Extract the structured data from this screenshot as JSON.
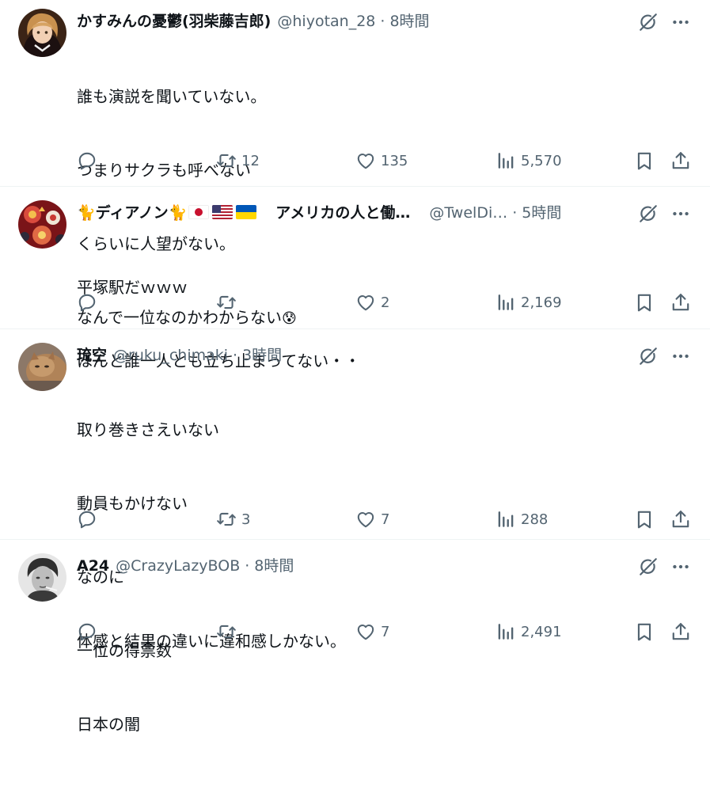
{
  "replies": [
    {
      "name": "かすみんの憂鬱(羽柴藤吉郎)",
      "handle": "@hiyotan_28",
      "time": "8時間",
      "lines": [
        "誰も演説を聞いていない。",
        "つまりサクラも呼べない",
        "くらいに人望がない。",
        "なんで一位なのかわからない"
      ],
      "emoji": "😰",
      "reply_count": "",
      "retweet_count": "12",
      "like_count": "135",
      "view_count": "5,570"
    },
    {
      "name_prefix": "🐈ディアノン🐈",
      "name_suffix": "アメリカの人と働…",
      "handle": "@TwelDi…",
      "time": "5時間",
      "lines": [
        "平塚駅だｗｗｗ",
        "ほんと誰一人とも立ち止まってない・・"
      ],
      "reply_count": "",
      "retweet_count": "",
      "like_count": "2",
      "view_count": "2,169"
    },
    {
      "name": "琉空",
      "handle": "@ruku_chimaki",
      "time": "3時間",
      "lines": [
        "取り巻きさえいない",
        "動員もかけない",
        "なのに",
        "一位の得票数",
        "日本の闇"
      ],
      "reply_count": "",
      "retweet_count": "3",
      "like_count": "7",
      "view_count": "288"
    },
    {
      "name": "A24",
      "handle": "@CrazyLazyBOB",
      "time": "8時間",
      "lines": [
        "体感と結果の違いに違和感しかない。"
      ],
      "reply_count": "",
      "retweet_count": "",
      "like_count": "7",
      "view_count": "2,491"
    }
  ],
  "separator": "·",
  "icons": [
    "grok-icon",
    "more-icon",
    "reply-icon",
    "retweet-icon",
    "like-icon",
    "views-icon",
    "bookmark-icon",
    "share-icon"
  ],
  "colors": {
    "text": "#0f1419",
    "secondary": "#536471",
    "border": "#eff3f4"
  }
}
